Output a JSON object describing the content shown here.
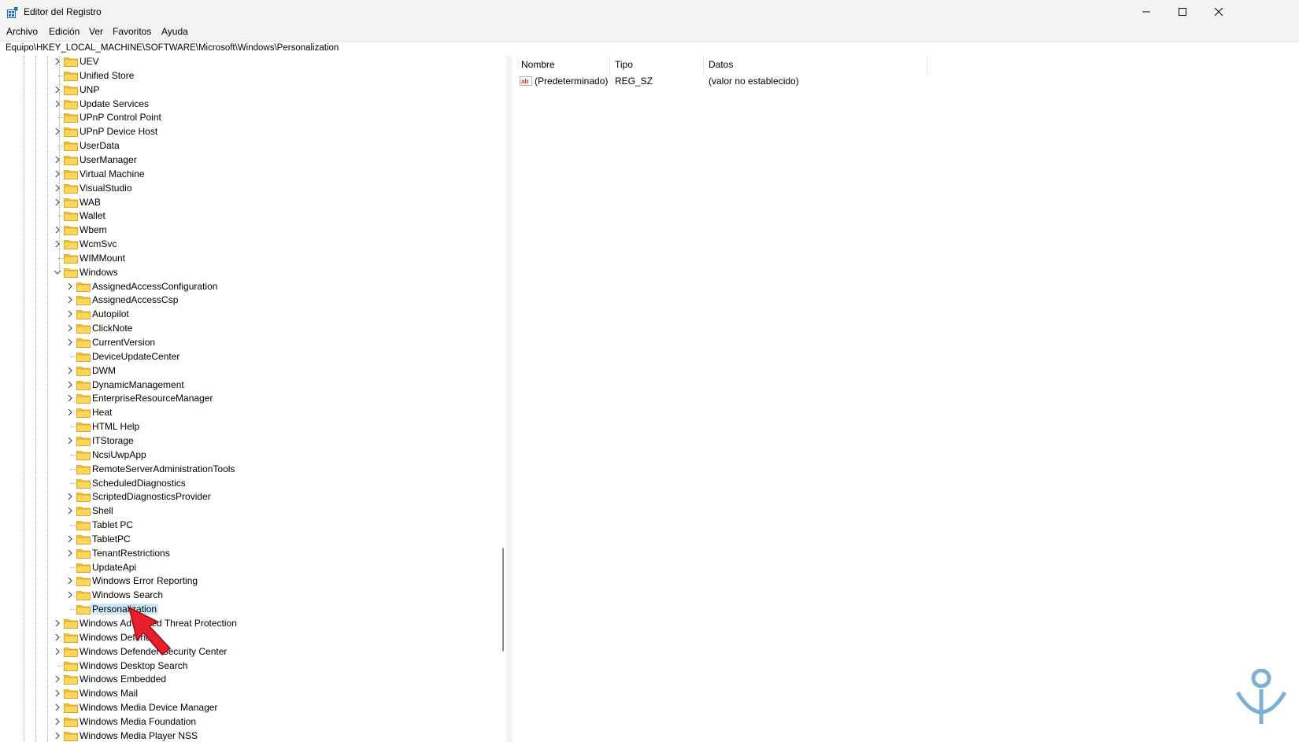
{
  "window": {
    "title": "Editor del Registro"
  },
  "menu": [
    "Archivo",
    "Edición",
    "Ver",
    "Favoritos",
    "Ayuda"
  ],
  "address": "Equipo\\HKEY_LOCAL_MACHINE\\SOFTWARE\\Microsoft\\Windows\\Personalization",
  "tree": {
    "items": [
      {
        "label": "UEV",
        "level": 1,
        "expander": "collapsed"
      },
      {
        "label": "Unified Store",
        "level": 1,
        "expander": "none"
      },
      {
        "label": "UNP",
        "level": 1,
        "expander": "collapsed"
      },
      {
        "label": "Update Services",
        "level": 1,
        "expander": "collapsed"
      },
      {
        "label": "UPnP Control Point",
        "level": 1,
        "expander": "none"
      },
      {
        "label": "UPnP Device Host",
        "level": 1,
        "expander": "collapsed"
      },
      {
        "label": "UserData",
        "level": 1,
        "expander": "none"
      },
      {
        "label": "UserManager",
        "level": 1,
        "expander": "collapsed"
      },
      {
        "label": "Virtual Machine",
        "level": 1,
        "expander": "collapsed"
      },
      {
        "label": "VisualStudio",
        "level": 1,
        "expander": "collapsed"
      },
      {
        "label": "WAB",
        "level": 1,
        "expander": "collapsed"
      },
      {
        "label": "Wallet",
        "level": 1,
        "expander": "none"
      },
      {
        "label": "Wbem",
        "level": 1,
        "expander": "collapsed"
      },
      {
        "label": "WcmSvc",
        "level": 1,
        "expander": "collapsed"
      },
      {
        "label": "WIMMount",
        "level": 1,
        "expander": "none"
      },
      {
        "label": "Windows",
        "level": 1,
        "expander": "expanded"
      },
      {
        "label": "AssignedAccessConfiguration",
        "level": 2,
        "expander": "collapsed"
      },
      {
        "label": "AssignedAccessCsp",
        "level": 2,
        "expander": "collapsed"
      },
      {
        "label": "Autopilot",
        "level": 2,
        "expander": "collapsed"
      },
      {
        "label": "ClickNote",
        "level": 2,
        "expander": "collapsed"
      },
      {
        "label": "CurrentVersion",
        "level": 2,
        "expander": "collapsed"
      },
      {
        "label": "DeviceUpdateCenter",
        "level": 2,
        "expander": "none"
      },
      {
        "label": "DWM",
        "level": 2,
        "expander": "collapsed"
      },
      {
        "label": "DynamicManagement",
        "level": 2,
        "expander": "collapsed"
      },
      {
        "label": "EnterpriseResourceManager",
        "level": 2,
        "expander": "collapsed"
      },
      {
        "label": "Heat",
        "level": 2,
        "expander": "collapsed"
      },
      {
        "label": "HTML Help",
        "level": 2,
        "expander": "none"
      },
      {
        "label": "ITStorage",
        "level": 2,
        "expander": "collapsed"
      },
      {
        "label": "NcsiUwpApp",
        "level": 2,
        "expander": "none"
      },
      {
        "label": "RemoteServerAdministrationTools",
        "level": 2,
        "expander": "none"
      },
      {
        "label": "ScheduledDiagnostics",
        "level": 2,
        "expander": "none"
      },
      {
        "label": "ScriptedDiagnosticsProvider",
        "level": 2,
        "expander": "collapsed"
      },
      {
        "label": "Shell",
        "level": 2,
        "expander": "collapsed"
      },
      {
        "label": "Tablet PC",
        "level": 2,
        "expander": "none"
      },
      {
        "label": "TabletPC",
        "level": 2,
        "expander": "collapsed"
      },
      {
        "label": "TenantRestrictions",
        "level": 2,
        "expander": "collapsed"
      },
      {
        "label": "UpdateApi",
        "level": 2,
        "expander": "none"
      },
      {
        "label": "Windows Error Reporting",
        "level": 2,
        "expander": "collapsed"
      },
      {
        "label": "Windows Search",
        "level": 2,
        "expander": "collapsed"
      },
      {
        "label": "Personalization",
        "level": 2,
        "expander": "none",
        "selected": true
      },
      {
        "label": "Windows Advanced Threat Protection",
        "level": 1,
        "expander": "collapsed"
      },
      {
        "label": "Windows Defender",
        "level": 1,
        "expander": "collapsed"
      },
      {
        "label": "Windows Defender Security Center",
        "level": 1,
        "expander": "collapsed"
      },
      {
        "label": "Windows Desktop Search",
        "level": 1,
        "expander": "none"
      },
      {
        "label": "Windows Embedded",
        "level": 1,
        "expander": "collapsed"
      },
      {
        "label": "Windows Mail",
        "level": 1,
        "expander": "collapsed"
      },
      {
        "label": "Windows Media Device Manager",
        "level": 1,
        "expander": "collapsed"
      },
      {
        "label": "Windows Media Foundation",
        "level": 1,
        "expander": "collapsed"
      },
      {
        "label": "Windows Media Player NSS",
        "level": 1,
        "expander": "collapsed"
      }
    ]
  },
  "values": {
    "columns": [
      "Nombre",
      "Tipo",
      "Datos"
    ],
    "rows": [
      {
        "name": "(Predeterminado)",
        "type": "REG_SZ",
        "data": "(valor no establecido)",
        "icon": "string-value-icon"
      }
    ]
  },
  "colors": {
    "folder": "#f5c42c",
    "selection": "#cce8ff",
    "arrow": "#ea1f2b",
    "watermark": "#7db0d5"
  }
}
